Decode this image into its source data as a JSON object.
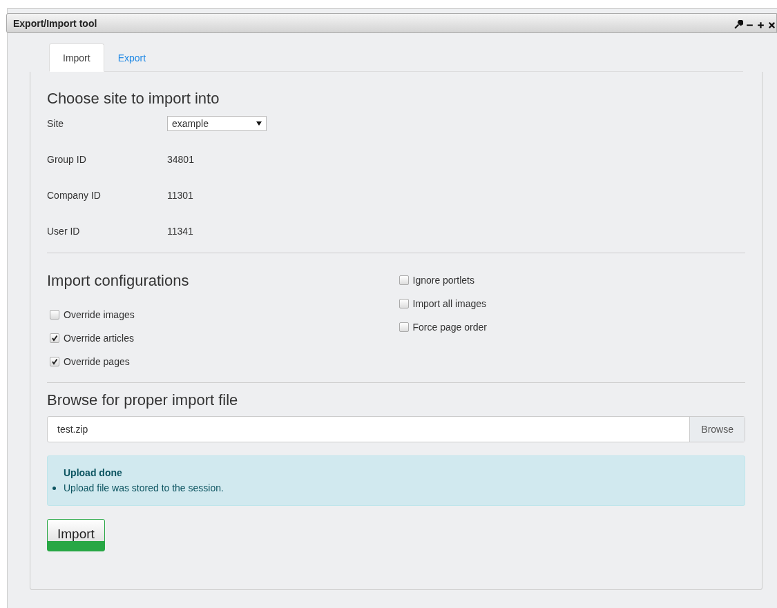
{
  "window": {
    "title": "Export/Import tool"
  },
  "tabs": [
    {
      "label": "Import",
      "selected": true
    },
    {
      "label": "Export",
      "selected": false
    }
  ],
  "site_section": {
    "heading": "Choose site to import into",
    "fields": [
      {
        "label": "Site",
        "kind": "select",
        "value": "example"
      },
      {
        "label": "Group ID",
        "kind": "text",
        "value": "34801"
      },
      {
        "label": "Company ID",
        "kind": "text",
        "value": "11301"
      },
      {
        "label": "User ID",
        "kind": "text",
        "value": "11341"
      }
    ]
  },
  "config_section": {
    "heading": "Import configurations",
    "left_options": [
      {
        "label": "Override images",
        "checked": false
      },
      {
        "label": "Override articles",
        "checked": true
      },
      {
        "label": "Override pages",
        "checked": true
      }
    ],
    "right_options": [
      {
        "label": "Ignore portlets",
        "checked": false
      },
      {
        "label": "Import all images",
        "checked": false
      },
      {
        "label": "Force page order",
        "checked": false
      }
    ]
  },
  "file_section": {
    "heading": "Browse for proper import file",
    "file_value": "test.zip",
    "browse_button": "Browse"
  },
  "alert": {
    "title": "Upload done",
    "items": [
      "Upload file was stored to the session."
    ]
  },
  "import_button": "Import"
}
